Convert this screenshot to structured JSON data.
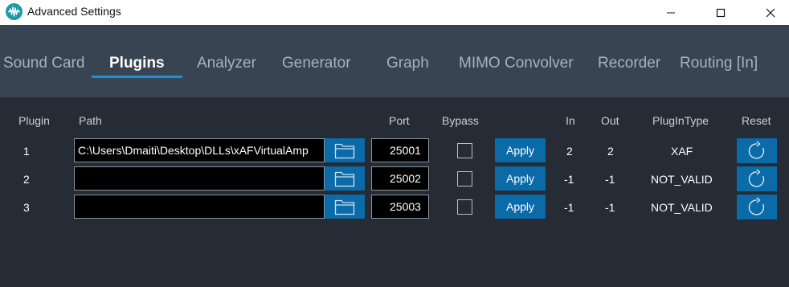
{
  "window": {
    "title": "Advanced Settings",
    "controls": [
      "minimize",
      "maximize",
      "close"
    ]
  },
  "tabs": [
    {
      "label": "Sound Card",
      "active": false
    },
    {
      "label": "Plugins",
      "active": true
    },
    {
      "label": "Analyzer",
      "active": false
    },
    {
      "label": "Generator",
      "active": false
    },
    {
      "label": "Graph",
      "active": false
    },
    {
      "label": "MIMO Convolver",
      "active": false
    },
    {
      "label": "Recorder",
      "active": false
    },
    {
      "label": "Routing [In]",
      "active": false
    }
  ],
  "table": {
    "headers": {
      "plugin": "Plugin",
      "path": "Path",
      "port": "Port",
      "bypass": "Bypass",
      "in": "In",
      "out": "Out",
      "plugin_type": "PlugInType",
      "reset": "Reset"
    },
    "rows": [
      {
        "plugin": "1",
        "path": "C:\\Users\\Dmaiti\\Desktop\\DLLs\\xAFVirtualAmp",
        "port": "25001",
        "bypass": false,
        "apply": "Apply",
        "in": "2",
        "out": "2",
        "plugin_type": "XAF"
      },
      {
        "plugin": "2",
        "path": "",
        "port": "25002",
        "bypass": false,
        "apply": "Apply",
        "in": "-1",
        "out": "-1",
        "plugin_type": "NOT_VALID"
      },
      {
        "plugin": "3",
        "path": "",
        "port": "25003",
        "bypass": false,
        "apply": "Apply",
        "in": "-1",
        "out": "-1",
        "plugin_type": "NOT_VALID"
      }
    ]
  },
  "icons": {
    "app": "waveform-icon",
    "browse": "folder-icon",
    "reset": "refresh-icon"
  },
  "colors": {
    "accent": "#1f8fd6",
    "button": "#0b6aa8",
    "tabs_background": "#394452",
    "content_background": "#252c35"
  }
}
